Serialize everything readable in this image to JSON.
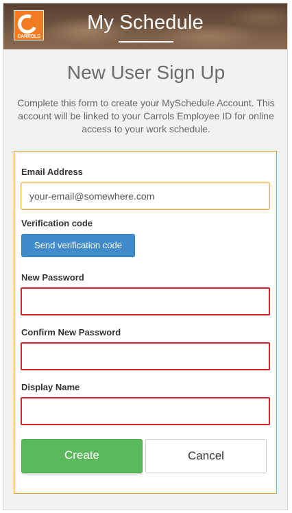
{
  "header": {
    "title": "My Schedule",
    "logo_text": "CARROLS"
  },
  "page": {
    "title": "New User Sign Up",
    "intro": "Complete this form to create your MySchedule Account. This account will be linked to your Carrols Employee ID for online access to your work schedule."
  },
  "form": {
    "email_label": "Email Address",
    "email_value": "your-email@somewhere.com",
    "verification_label": "Verification code",
    "send_code_label": "Send verification code",
    "new_password_label": "New Password",
    "confirm_password_label": "Confirm New Password",
    "display_name_label": "Display Name",
    "create_label": "Create",
    "cancel_label": "Cancel"
  },
  "colors": {
    "brand_orange": "#f47c20",
    "form_border": "#e8a020",
    "primary_blue": "#428bca",
    "success_green": "#5cb85c",
    "error_red": "#d9232b"
  }
}
